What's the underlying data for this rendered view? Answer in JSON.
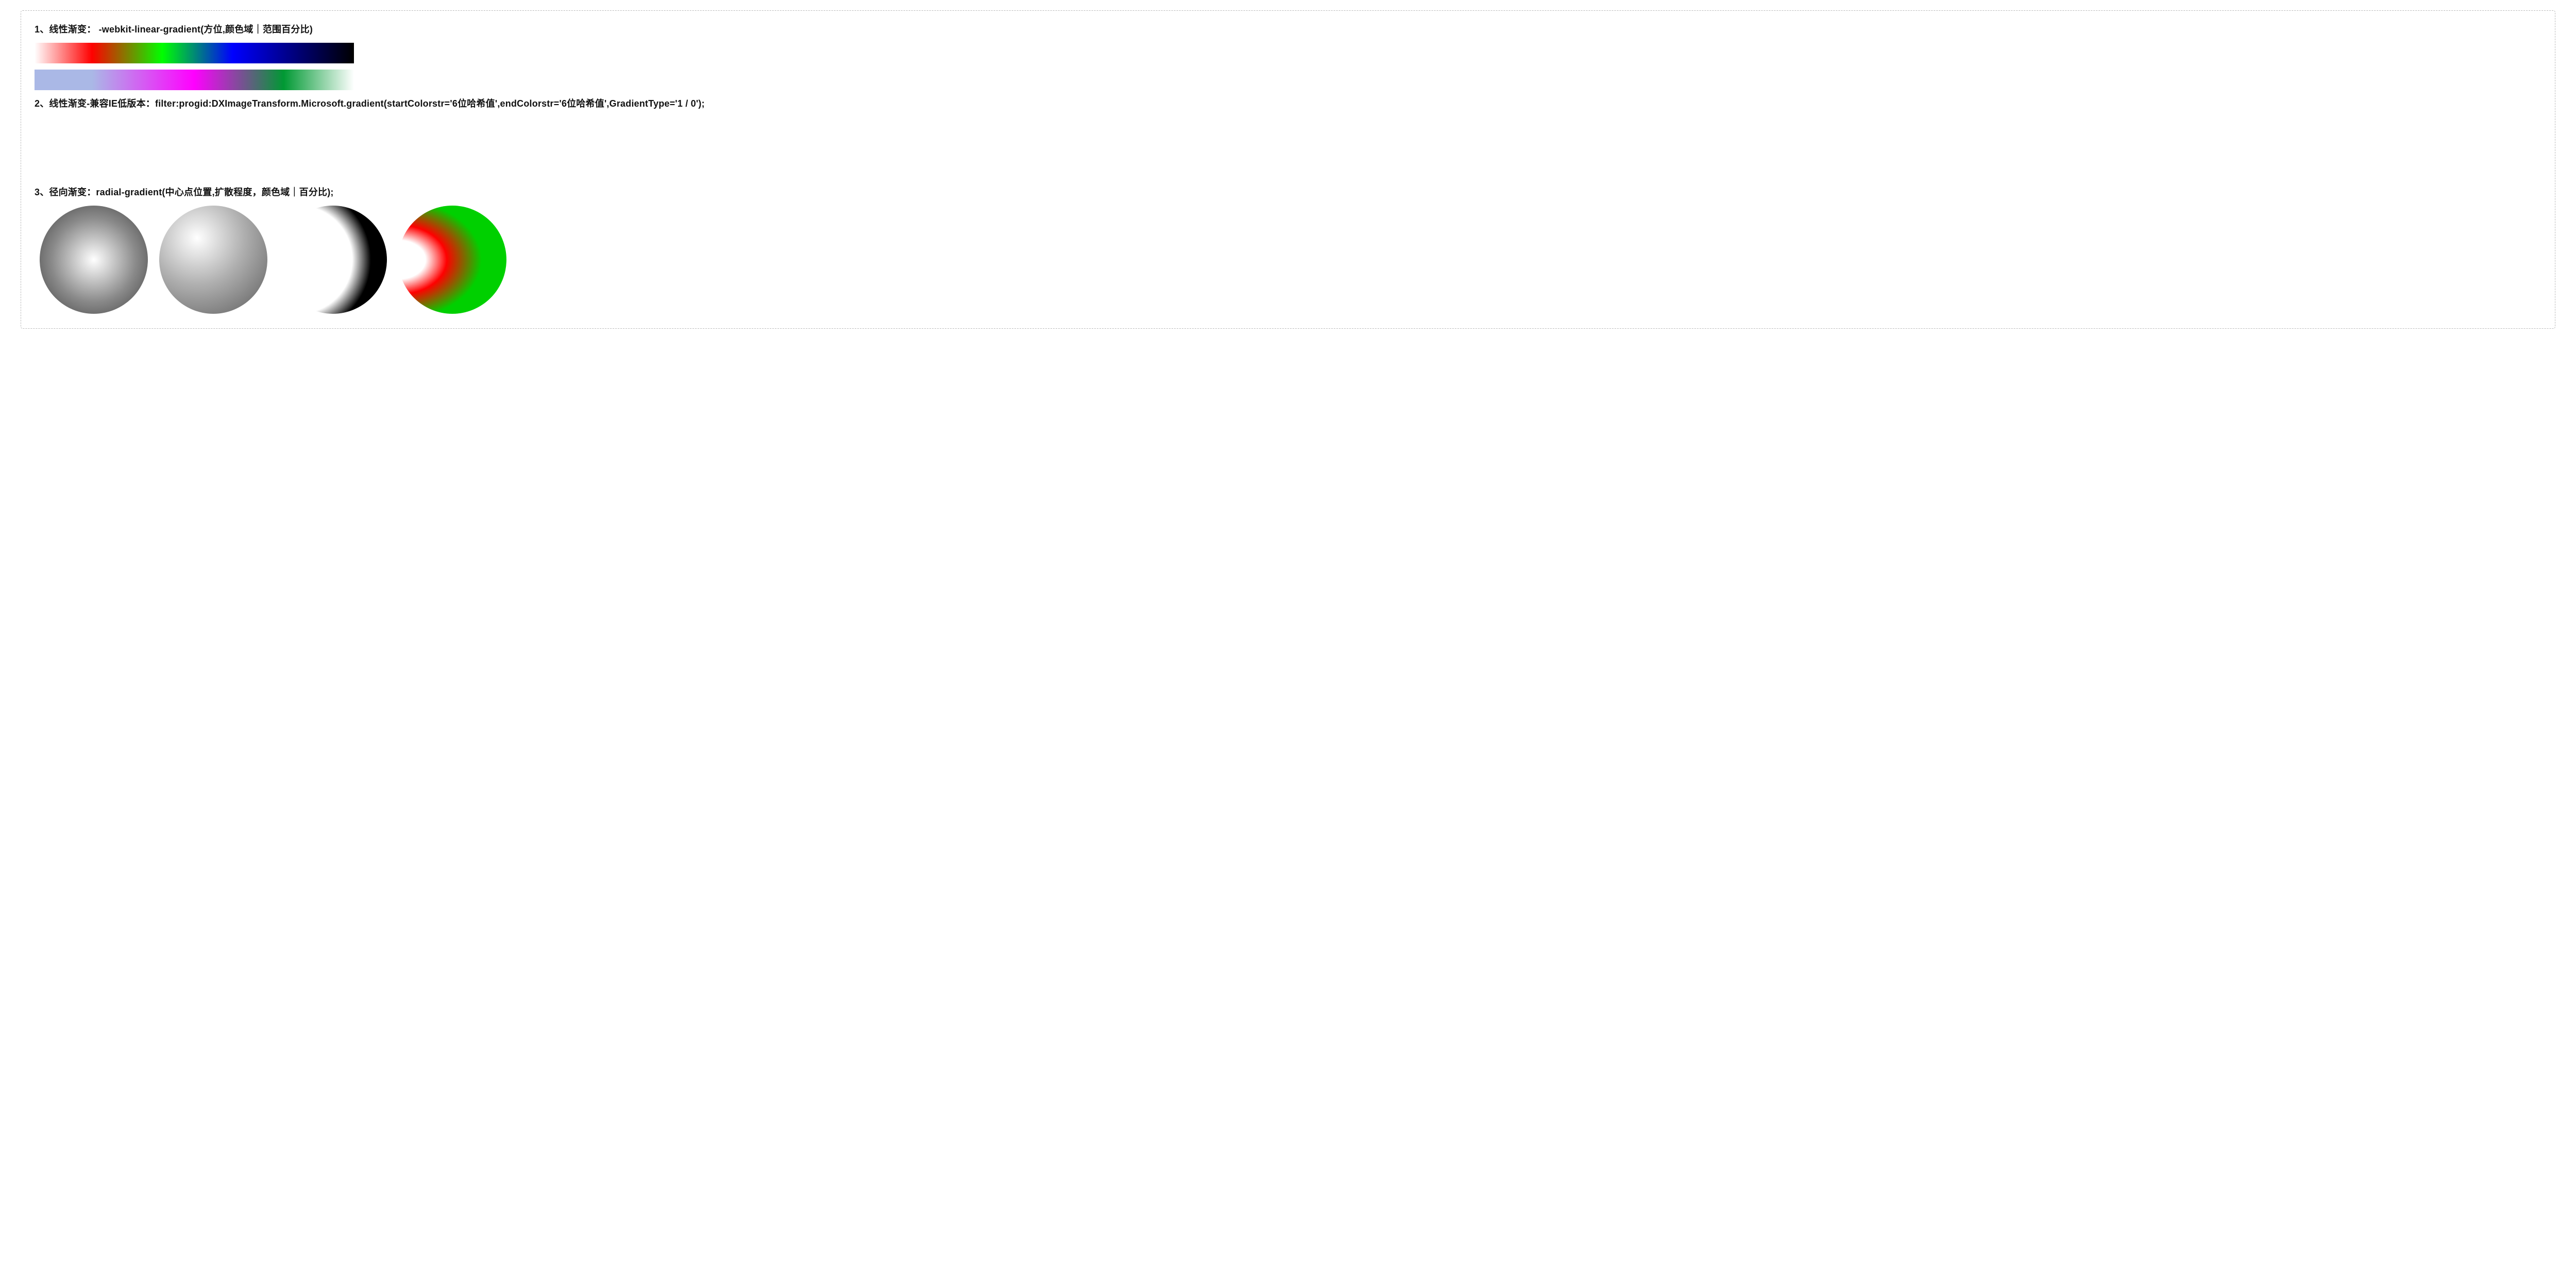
{
  "section1": {
    "title": "1、线性渐变： -webkit-linear-gradient(方位,颜色域｜范围百分比)"
  },
  "section2": {
    "title": "2、线性渐变-兼容IE低版本：filter:progid:DXImageTransform.Microsoft.gradient(startColorstr='6位哈希值',endColorstr='6位哈希值',GradientType='1 / 0');"
  },
  "section3": {
    "title": "3、径向渐变：radial-gradient(中心点位置,扩散程度，颜色域｜百分比);"
  },
  "chart_data": [
    {
      "type": "bar",
      "subtype": "linear-gradient-demo",
      "direction": "to right",
      "stops": [
        {
          "color": "#ffffff",
          "pos": "0%"
        },
        {
          "color": "#ff0000",
          "pos": "18%"
        },
        {
          "color": "#00ff00",
          "pos": "40%"
        },
        {
          "color": "#0000ff",
          "pos": "62%"
        },
        {
          "color": "#000000",
          "pos": "100%"
        }
      ]
    },
    {
      "type": "bar",
      "subtype": "linear-gradient-demo",
      "direction": "to right",
      "stops": [
        {
          "color": "#aab8e6",
          "pos": "0%"
        },
        {
          "color": "#aab8e6",
          "pos": "18%"
        },
        {
          "color": "#ff00ff",
          "pos": "50%"
        },
        {
          "color": "#009933",
          "pos": "78%"
        },
        {
          "color": "#ffffff",
          "pos": "100%"
        }
      ]
    },
    {
      "type": "pie",
      "subtype": "radial-gradient-demo",
      "center": "50% 50%",
      "stops": [
        {
          "color": "#ffffff",
          "pos": "0%"
        },
        {
          "color": "#8a8a8a",
          "pos": "55%"
        },
        {
          "color": "#3d3d3d",
          "pos": "100%"
        }
      ]
    },
    {
      "type": "pie",
      "subtype": "radial-gradient-demo",
      "center": "35% 30%",
      "stops": [
        {
          "color": "#ffffff",
          "pos": "0%"
        },
        {
          "color": "#b0b0b0",
          "pos": "45%"
        },
        {
          "color": "#5a5a5a",
          "pos": "100%"
        }
      ]
    },
    {
      "type": "pie",
      "subtype": "radial-gradient-demo",
      "center": "18% 50%",
      "stops": [
        {
          "color": "#ffffff",
          "pos": "0%"
        },
        {
          "color": "#ffffff",
          "pos": "52%"
        },
        {
          "color": "#000000",
          "pos": "70%"
        },
        {
          "color": "#000000",
          "pos": "100%"
        }
      ]
    },
    {
      "type": "pie",
      "subtype": "radial-gradient-demo",
      "center": "0% 50%",
      "shape": "ellipse 140% 100%",
      "stops": [
        {
          "color": "#ffffff",
          "pos": "0%"
        },
        {
          "color": "#ffffff",
          "pos": "18%"
        },
        {
          "color": "#ff0000",
          "pos": "32%"
        },
        {
          "color": "#00d000",
          "pos": "55%"
        },
        {
          "color": "#00d000",
          "pos": "72%"
        },
        {
          "color": "#0000ff",
          "pos": "100%"
        }
      ]
    }
  ]
}
